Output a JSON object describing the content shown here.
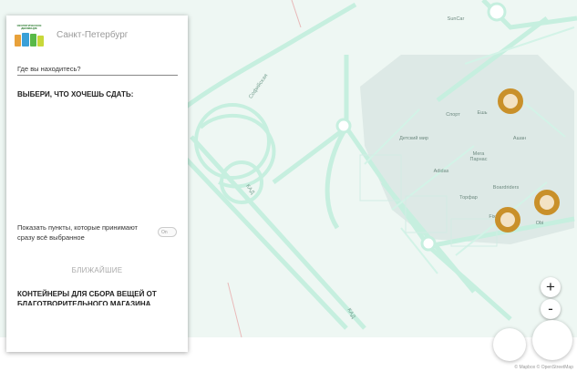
{
  "panel": {
    "logo_text": "ЭКОЛОГИЧЕСКОЕ ДВИЖЕНИЕ РАЗДЕЛЬНЫЙ СБОР",
    "city": "Санкт-Петербург",
    "location_placeholder": "Где вы находитесь?",
    "choose_heading": "ВЫБЕРИ, ЧТО ХОЧЕШЬ СДАТЬ:",
    "accept_all_label": "Показать пункты, которые принимают сразу всё выбранное",
    "toggle_label": "On",
    "nearest_label": "БЛИЖАЙШИЕ",
    "containers_heading": "КОНТЕЙНЕРЫ ДЛЯ СБОРА ВЕЩЕЙ ОТ БЛАГОТВОРИТЕЛЬНОГО МАГАЗИНА"
  },
  "map": {
    "road_labels": [
      "Софийская",
      "КАД",
      "КАД"
    ],
    "places": [
      "SunCar",
      "Спорт",
      "Ешь",
      "Детский мир",
      "Ашан",
      "Мега Парнас",
      "Adidas",
      "Boardriders",
      "Торфар",
      "Fix",
      "Obi"
    ],
    "zoom_in": "+",
    "zoom_out": "-",
    "attribution": "© Mapbox © OpenStreetMap"
  },
  "colors": {
    "pin": "#c9902a",
    "road": "#bfeede",
    "map_bg": "#eef7f3"
  }
}
